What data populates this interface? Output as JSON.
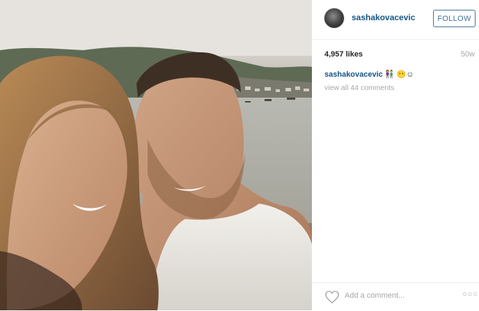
{
  "post": {
    "username": "sashakovacevic",
    "follow_label": "FOLLOW",
    "likes": "4,957 likes",
    "age": "50w",
    "caption": {
      "username": "sashakovacevic",
      "emoji": "👫 😶☺"
    },
    "view_comments": "view all 44 comments",
    "add_comment_placeholder": "Add a comment...",
    "more_label": "○○○"
  },
  "colors": {
    "link": "#125688",
    "follow": "#3f729b",
    "muted": "#a5a7aa"
  }
}
